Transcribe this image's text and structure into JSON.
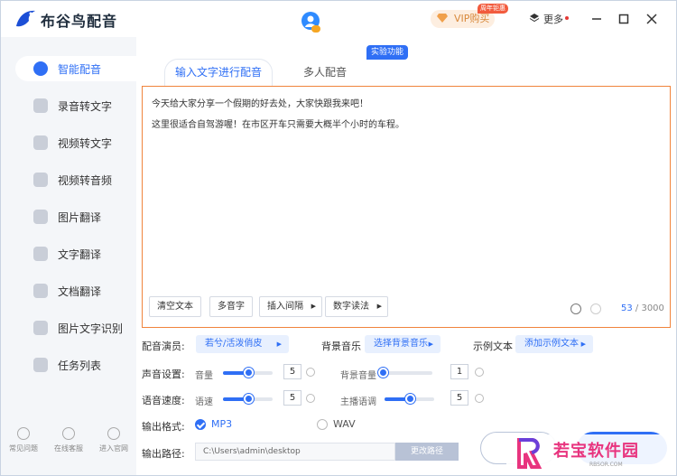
{
  "app": {
    "title": "布谷鸟配音"
  },
  "header": {
    "vip_label": "VIP购买",
    "vip_tag": "周年钜惠",
    "more_label": "更多"
  },
  "sidebar": {
    "items": [
      {
        "label": "智能配音",
        "active": true
      },
      {
        "label": "录音转文字"
      },
      {
        "label": "视频转文字"
      },
      {
        "label": "视频转音频"
      },
      {
        "label": "图片翻译"
      },
      {
        "label": "文字翻译"
      },
      {
        "label": "文档翻译"
      },
      {
        "label": "图片文字识别"
      },
      {
        "label": "任务列表"
      }
    ],
    "footer": [
      {
        "label": "常见问题"
      },
      {
        "label": "在线客服"
      },
      {
        "label": "进入官网"
      }
    ]
  },
  "tabs": {
    "active": "输入文字进行配音",
    "second": "多人配音",
    "badge": "实验功能"
  },
  "editor": {
    "lines": [
      "今天给大家分享一个假期的好去处，大家快跟我来吧！",
      "这里很适合自驾游喔！在市区开车只需要大概半个小时的车程。"
    ],
    "count_current": "53",
    "count_total": " / 3000"
  },
  "toolbar": {
    "clear": "清空文本",
    "polyphone": "多音字",
    "insert_pause": "插入间隔",
    "number_read": "数字读法"
  },
  "settings": {
    "voice_label": "配音演员:",
    "voice_value": "若兮/活泼俏皮",
    "bgm_label": "背景音乐",
    "bgm_value": "选择背景音乐",
    "sample_label": "示例文本",
    "sample_value": "添加示例文本",
    "sound_label": "声音设置:",
    "volume_label": "音量",
    "volume_value": "5",
    "volume_level": 0.5,
    "bg_volume_label": "背景音量",
    "bg_volume_value": "1",
    "bg_volume_level": 0.0,
    "speed_label": "语音速度:",
    "speed_sub_label": "语速",
    "speed_value": "5",
    "speed_level": 0.5,
    "pitch_label": "主播语调",
    "pitch_value": "5",
    "pitch_level": 0.5,
    "format_label": "输出格式:",
    "format_mp3": "MP3",
    "format_wav": "WAV",
    "format_selected": "MP3",
    "path_label": "输出路径:",
    "path_value": "C:\\Users\\admin\\desktop",
    "change_path": "更改路径"
  },
  "watermark": {
    "text": "若宝软件园",
    "sub": "RBSOR.COM"
  },
  "colors": {
    "accent": "#2f6ff5",
    "editor_border": "#f0843c",
    "vip_bg": "#fdeee0",
    "vip_text": "#d8893c"
  }
}
